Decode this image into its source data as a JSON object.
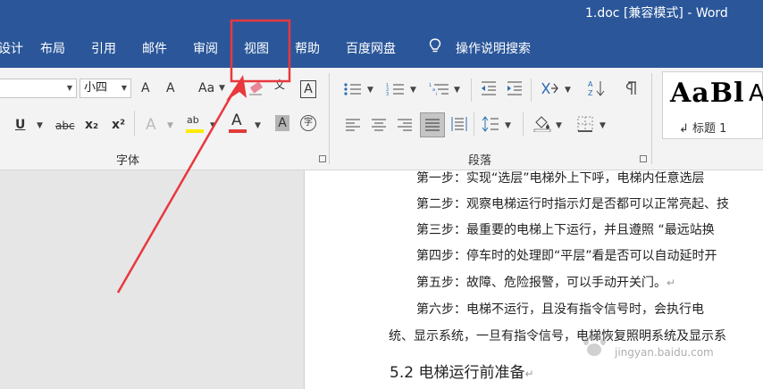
{
  "window": {
    "title": "1.doc [兼容模式]  -  Word"
  },
  "tabs": [
    {
      "label": "设计"
    },
    {
      "label": "布局"
    },
    {
      "label": "引用"
    },
    {
      "label": "邮件"
    },
    {
      "label": "审阅"
    },
    {
      "label": "视图"
    },
    {
      "label": "帮助"
    },
    {
      "label": "百度网盘"
    }
  ],
  "tell_me": {
    "label": "操作说明搜索",
    "icon": "lightbulb-icon"
  },
  "font": {
    "size_value": "小四",
    "grow_label": "A",
    "shrink_label": "A",
    "change_case_label": "Aa",
    "underline_label": "U",
    "strikethrough_label": "abc",
    "subscript_label": "x₂",
    "superscript_label": "x²",
    "text_effects_label": "A",
    "highlight_label": "ab",
    "font_color_label": "A",
    "char_shading_label": "A",
    "enclose_label": "字",
    "phonetic_label": "文",
    "border_label": "A",
    "group_label": "字体"
  },
  "paragraph": {
    "group_label": "段落"
  },
  "styles": {
    "preview": "AaBl",
    "name": "↲ 标题 1",
    "preview2": "A"
  },
  "colors": {
    "title_bar": "#2b579a",
    "highlight_annotation": "#e8383d",
    "highlight_yellow": "#ffeb00",
    "font_red": "#e03a3a"
  },
  "document": {
    "paragraphs": [
      {
        "text": "第一步：实现“选层”电梯外上下呼，电梯内任意选层",
        "mark": ""
      },
      {
        "text": "第二步：观察电梯运行时指示灯是否都可以正常亮起、技",
        "mark": ""
      },
      {
        "text": "第三步：最重要的电梯上下运行，并且遵照 “最远站换",
        "mark": ""
      },
      {
        "text": "第四步：停车时的处理即“平层”看是否可以自动延时开",
        "mark": ""
      },
      {
        "text": "第五步：故障、危险报警，可以手动开关门。",
        "mark": "↵"
      },
      {
        "text": "第六步：电梯不运行，且没有指令信号时，会执行电",
        "mark": ""
      },
      {
        "text": "统、显示系统，一旦有指令信号，电梯恢复照明系统及显示系",
        "mark": ""
      }
    ],
    "heading": "5.2 电梯运行前准备",
    "heading_mark": "↵"
  },
  "watermark": {
    "text": "jingyan.baidu.com"
  }
}
